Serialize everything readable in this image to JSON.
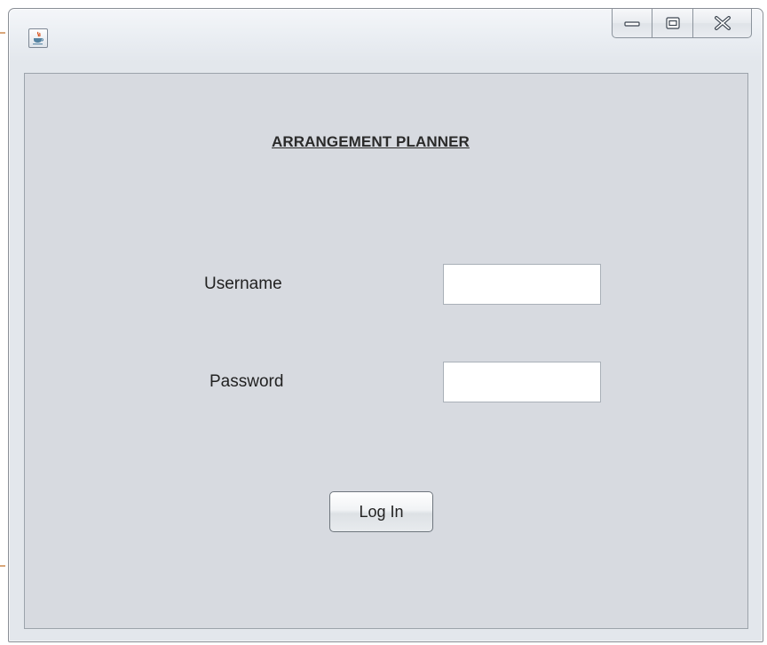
{
  "window": {
    "title": "",
    "controls": {
      "minimize_icon": "minimize-icon",
      "maximize_icon": "maximize-icon",
      "close_icon": "close-icon"
    }
  },
  "form": {
    "heading": "ARRANGEMENT PLANNER",
    "username_label": "Username",
    "username_value": "",
    "password_label": "Password",
    "password_value": "",
    "login_label": "Log In"
  },
  "colors": {
    "panel_background": "#d7dae0",
    "window_frame": "#e3e7ec",
    "text": "#222222"
  }
}
